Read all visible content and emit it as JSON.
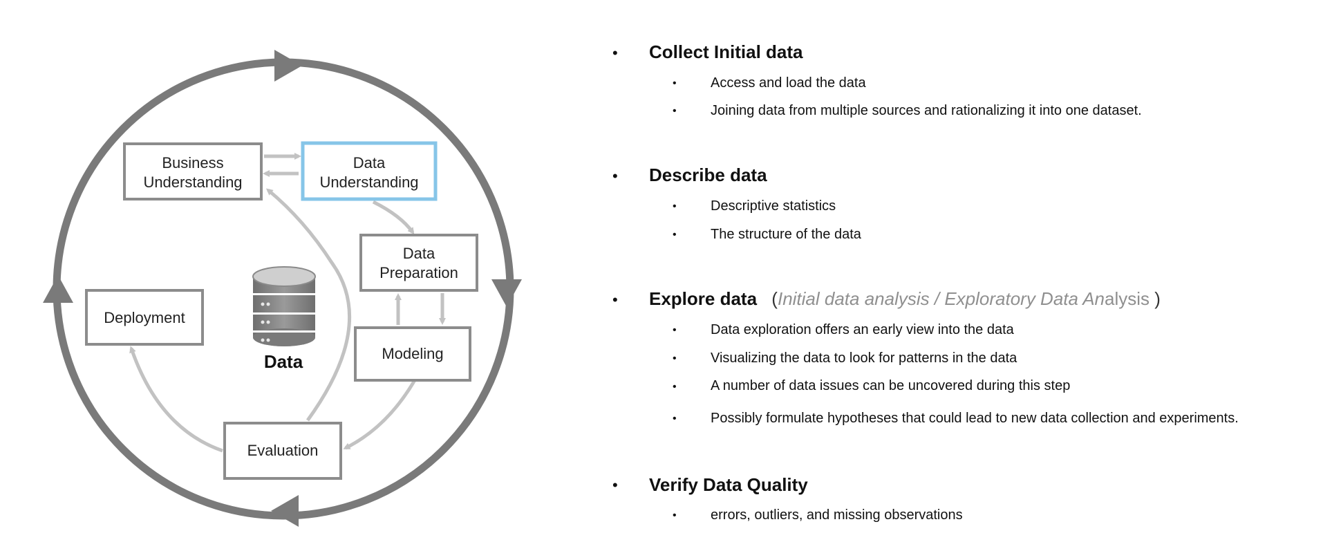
{
  "diagram": {
    "stages": [
      {
        "id": "business",
        "lines": [
          "Business",
          "Understanding"
        ]
      },
      {
        "id": "data-understanding",
        "lines": [
          "Data",
          "Understanding"
        ],
        "highlighted": true
      },
      {
        "id": "data-preparation",
        "lines": [
          "Data",
          "Preparation"
        ]
      },
      {
        "id": "modeling",
        "lines": [
          "Modeling"
        ]
      },
      {
        "id": "evaluation",
        "lines": [
          "Evaluation"
        ]
      },
      {
        "id": "deployment",
        "lines": [
          "Deployment"
        ]
      }
    ],
    "center_label": "Data",
    "center_icon": "database-icon",
    "colors": {
      "outer_ring": "#7a7a7a",
      "inner_arrows": "#c2c2c2",
      "box_border": "#8c8c8c",
      "highlight_border": "#86c5e8"
    }
  },
  "notes": {
    "bullet": "•",
    "sections": [
      {
        "title": "Collect Initial data",
        "items": [
          "Access and load the data",
          "Joining data from multiple sources and rationalizing it into one dataset."
        ]
      },
      {
        "title": "Describe data",
        "items": [
          "Descriptive statistics",
          "The structure of the data"
        ]
      },
      {
        "title": "Explore data",
        "note_open": "(",
        "note_italic": "Initial data analysis / Exploratory Data An",
        "note_plain": "alysis",
        "note_close": ")",
        "items": [
          "Data exploration offers an early view into the data",
          "Visualizing the data to look for patterns in the data",
          "A number of data issues can be uncovered during this step",
          "Possibly formulate hypotheses that could lead to new data collection and experiments."
        ]
      },
      {
        "title": "Verify Data Quality",
        "items": [
          "errors, outliers, and missing observations"
        ]
      }
    ]
  }
}
